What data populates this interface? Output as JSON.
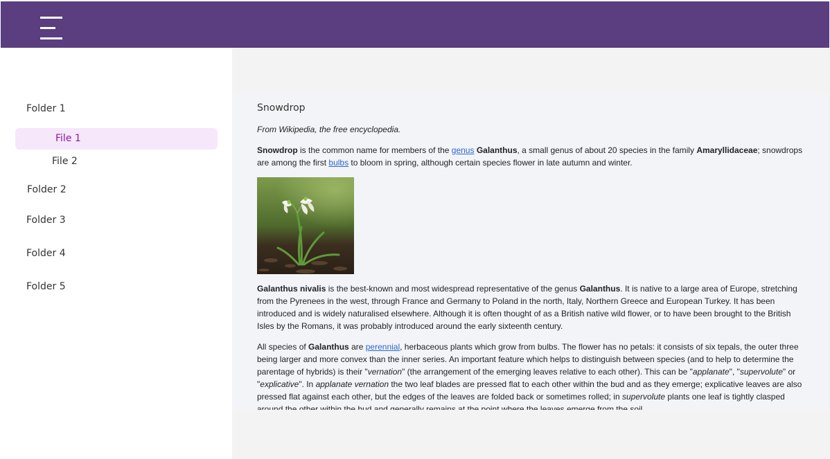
{
  "sidebar": {
    "folders": [
      "Folder 1",
      "Folder 2",
      "Folder 3",
      "Folder 4",
      "Folder 5"
    ],
    "files": [
      "File 1",
      "File 2"
    ],
    "active_file": "File 1"
  },
  "article": {
    "title": "Snowdrop",
    "subtitle": "From Wikipedia, the free encyclopedia.",
    "p1": {
      "t1": "Snowdrop",
      "t2": " is the common name for members of the ",
      "link_genus": "genus",
      "t3": " ",
      "t4": "Galanthus",
      "t5": ", a small genus of about 20 species in the family ",
      "t6": "Amaryllidaceae",
      "t7": "; snowdrops are among the first ",
      "link_bulbs": "bulbs",
      "t8": " to bloom in spring, although certain species flower in late autumn and winter."
    },
    "p2": {
      "t1": "Galanthus nivalis",
      "t2": " is the best-known and most widespread representative of the genus ",
      "t3": "Galanthus",
      "t4": ". It is native to a large area of Europe, stretching from the Pyrenees in the west, through France and Germany to Poland in the north, Italy, Northern Greece and European Turkey. It has been introduced and is widely naturalised elsewhere. Although it is often thought of as a British native wild flower, or to have been brought to the British Isles by the Romans, it was probably introduced around the early sixteenth century."
    },
    "p3": {
      "t1": "All species of ",
      "t2": "Galanthus",
      "t3": " are ",
      "link_perennial": "perennial",
      "t4": ", herbaceous plants which grow from bulbs. The flower has no petals: it consists of six tepals, the outer three being larger and more convex than the inner series. An important feature which helps to distinguish between species (and to help to determine the parentage of hybrids) is their \"",
      "t5": "vernation",
      "t6": "\" (the arrangement of the emerging leaves relative to each other). This can be \"",
      "t7": "applanate",
      "t8": "\", \"",
      "t9": "supervolute",
      "t10": "\" or \"",
      "t11": "explicative",
      "t12": "\". In ",
      "t13": "applanate vernation",
      "t14": " the two leaf blades are pressed flat to each other within the bud and as they emerge; explicative leaves are also pressed flat against each other, but the edges of the leaves are folded back or sometimes rolled; in ",
      "t15": "supervolute",
      "t16": " plants one leaf is tightly clasped around the other within the bud and generally remains at the point where the leaves emerge from the soil."
    }
  },
  "colors": {
    "header": "#5a3e80",
    "active_bg": "#f6e7fb",
    "active_text": "#8c1a9e",
    "link": "#2a66cc"
  }
}
